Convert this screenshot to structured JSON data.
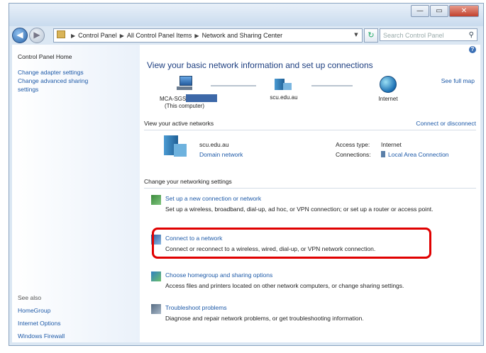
{
  "window": {
    "controls": {
      "minimize": "—",
      "maximize": "▭",
      "close": "✕"
    }
  },
  "nav": {
    "back_icon": "arrow-left-icon",
    "forward_icon": "arrow-right-icon",
    "breadcrumb": [
      "Control Panel",
      "All Control Panel Items",
      "Network and Sharing Center"
    ],
    "search_placeholder": "Search Control Panel"
  },
  "sidebar": {
    "home": "Control Panel Home",
    "links": [
      "Change adapter settings",
      "Change advanced sharing",
      "settings"
    ],
    "see_also_title": "See also",
    "see_also": [
      "HomeGroup",
      "Internet Options",
      "Windows Firewall"
    ]
  },
  "main": {
    "heading": "View your basic network information and set up connections",
    "see_full_map": "See full map",
    "map": {
      "computer_name": "MCA-SGS",
      "computer_sub": "(This computer)",
      "network_name": "scu.edu.au",
      "internet": "Internet"
    },
    "active_title": "View your active networks",
    "connect_disconnect": "Connect or disconnect",
    "active": {
      "name": "scu.edu.au",
      "type": "Domain network",
      "access_type_label": "Access type:",
      "access_type_value": "Internet",
      "connections_label": "Connections:",
      "connections_value": "Local Area Connection"
    },
    "change_title": "Change your networking settings",
    "tasks": [
      {
        "title": "Set up a new connection or network",
        "desc": "Set up a wireless, broadband, dial-up, ad hoc, or VPN connection; or set up a router or access point."
      },
      {
        "title": "Connect to a network",
        "desc": "Connect or reconnect to a wireless, wired, dial-up, or VPN network connection."
      },
      {
        "title": "Choose homegroup and sharing options",
        "desc": "Access files and printers located on other network computers, or change sharing settings."
      },
      {
        "title": "Troubleshoot problems",
        "desc": "Diagnose and repair network problems, or get troubleshooting information."
      }
    ]
  },
  "colors": {
    "highlight": "#e00000",
    "link": "#1e5aa8",
    "heading": "#1e3f80"
  }
}
